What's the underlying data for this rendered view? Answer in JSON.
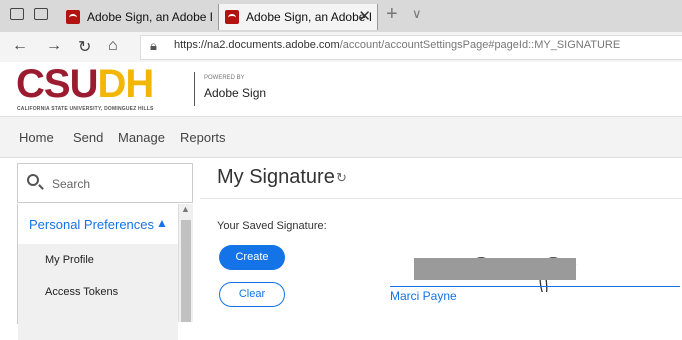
{
  "browser": {
    "tabs": [
      {
        "title": "Adobe Sign, an Adobe Doc",
        "active": false
      },
      {
        "title": "Adobe Sign, an Adobe I",
        "active": true
      }
    ],
    "close_glyph": "✕",
    "new_tab_glyph": "+",
    "tab_list_glyph": "∨",
    "nav": {
      "back": "←",
      "forward": "→",
      "refresh": "↻",
      "home": "⌂"
    },
    "url_main": "https://na2.documents.adobe.com",
    "url_rest": "/account/accountSettingsPage#pageId::MY_SIGNATURE"
  },
  "header": {
    "logo_red": "CSU",
    "logo_gold": "DH",
    "logo_subtitle": "CALIFORNIA STATE UNIVERSITY, DOMINGUEZ HILLS",
    "powered_by": "POWERED BY",
    "product": "Adobe Sign"
  },
  "menu": [
    "Home",
    "Send",
    "Manage",
    "Reports"
  ],
  "sidebar": {
    "search_placeholder": "Search",
    "section": "Personal Preferences",
    "items": [
      "My Profile",
      "Access Tokens"
    ]
  },
  "main": {
    "title": "My Signature",
    "saved_label": "Your Saved Signature:",
    "create_label": "Create",
    "clear_label": "Clear",
    "signer_name": "Marci Payne"
  },
  "colors": {
    "accent": "#1473e6",
    "brand_red": "#9b1b30",
    "brand_gold": "#f2b705"
  }
}
